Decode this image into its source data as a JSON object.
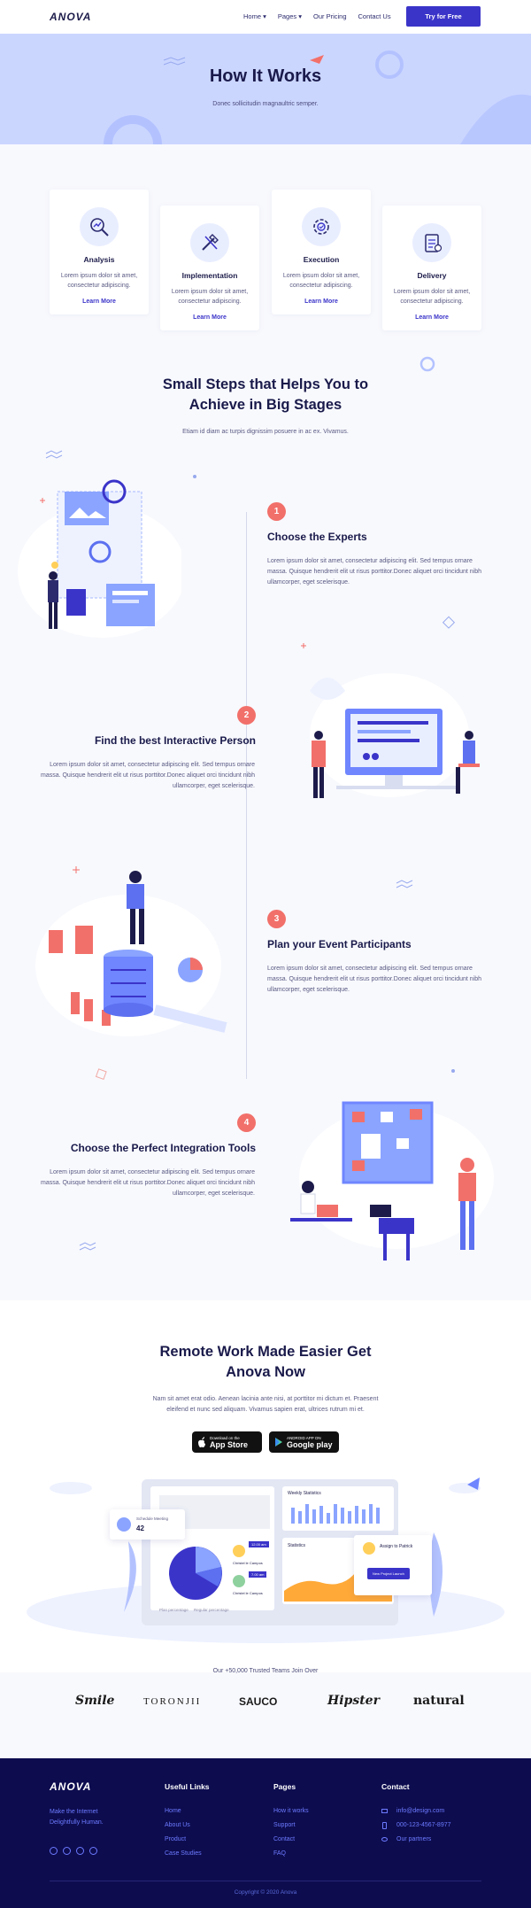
{
  "nav": {
    "logo": "ANOVA",
    "links": [
      "Home ▾",
      "Pages ▾",
      "Our Pricing",
      "Contact Us"
    ],
    "cta": "Try for Free"
  },
  "hero": {
    "title": "How It Works",
    "subtitle": "Donec sollicitudin magnaultric semper."
  },
  "features": [
    {
      "title": "Analysis",
      "text": "Lorem ipsum dolor sit amet, consectetur adipiscing.",
      "link": "Learn More",
      "icon": "magnifier-chart-icon"
    },
    {
      "title": "Implementation",
      "text": "Lorem ipsum dolor sit amet, consectetur adipiscing.",
      "link": "Learn More",
      "icon": "tools-icon"
    },
    {
      "title": "Execution",
      "text": "Lorem ipsum dolor sit amet, consectetur adipiscing.",
      "link": "Learn More",
      "icon": "gear-icon"
    },
    {
      "title": "Delivery",
      "text": "Lorem ipsum dolor sit amet, consectetur adipiscing.",
      "link": "Learn More",
      "icon": "checklist-icon"
    }
  ],
  "steps_section": {
    "title_line1": "Small Steps that Helps You to",
    "title_line2": "Achieve in Big Stages",
    "subtitle": "Etiam id diam ac turpis dignissim posuere in ac ex. Vivamus."
  },
  "steps": [
    {
      "number": "1",
      "title": "Choose the Experts",
      "text": "Lorem ipsum dolor sit amet, consectetur adipiscing elit. Sed tempus ornare massa. Quisque hendrerit elit ut risus porttitor.Donec aliquet orci tincidunt nibh ullamcorper, eget scelerisque."
    },
    {
      "number": "2",
      "title": "Find the best Interactive Person",
      "text": "Lorem ipsum dolor sit amet, consectetur adipiscing elit. Sed tempus ornare massa. Quisque hendrerit elit ut risus porttitor.Donec aliquet orci tincidunt nibh ullamcorper, eget scelerisque."
    },
    {
      "number": "3",
      "title": "Plan your Event Participants",
      "text": "Lorem ipsum dolor sit amet, consectetur adipiscing elit. Sed tempus ornare massa. Quisque hendrerit elit ut risus porttitor.Donec aliquet orci tincidunt nibh ullamcorper, eget scelerisque."
    },
    {
      "number": "4",
      "title": "Choose the Perfect Integration Tools",
      "text": "Lorem ipsum dolor sit amet, consectetur adipiscing elit. Sed tempus ornare massa. Quisque hendrerit elit ut risus porttitor.Donec aliquet orci tincidunt nibh ullamcorper, eget scelerisque."
    }
  ],
  "app_section": {
    "title_line1": "Remote Work Made Easier Get",
    "title_line2": "Anova Now",
    "text_line1": "Nam sit amet erat odio. Aenean lacinia ante nisi, at porttitor mi dictum et. Praesent",
    "text_line2": "eleifend et nunc sed aliquam. Vivamus sapien erat, ultrices rutrum mi et.",
    "appstore_top": "Download on the",
    "appstore_main": "App Store",
    "play_top": "ANDROID APP ON",
    "play_main": "Google play"
  },
  "dashboard": {
    "schedule_label": "Schedule Meeting",
    "schedule_value": "42",
    "weekly_label": "Weekly Statistics",
    "statistics_label": "Statistics",
    "assign_label": "Assign to Patrick",
    "new_project": "New Project Launch",
    "person1": "Christel le Campos",
    "person2": "Christel le Campos",
    "time1": "12.00 am",
    "time2": "7.00 am",
    "legend1": "Plan percentage",
    "legend2": "Regular percentage"
  },
  "trusted": {
    "text": "Our +50,000 Trusted Teams Join Over",
    "brands": [
      "Smile",
      "TORONJII",
      "SAUCO",
      "Hipster",
      "natural"
    ]
  },
  "footer": {
    "logo": "ANOVA",
    "tag_line1": "Make the Internet",
    "tag_line2": "Delightfully Human.",
    "useful_title": "Useful Links",
    "useful": [
      "Home",
      "About Us",
      "Product",
      "Case Studies"
    ],
    "pages_title": "Pages",
    "pages": [
      "How it works",
      "Support",
      "Contact",
      "FAQ"
    ],
    "contact_title": "Contact",
    "contact": [
      "info@design.com",
      "000-123-4567-8977",
      "Our partners"
    ],
    "social": [
      "facebook-icon",
      "twitter-icon",
      "linkedin-icon",
      "instagram-icon"
    ],
    "copyright": "Copyright © 2020 Anova"
  },
  "colors": {
    "accent": "#3b34c9",
    "hero_bg": "#cbd6ff",
    "step_badge": "#f2706a",
    "footer_bg": "#0d0c4f"
  }
}
